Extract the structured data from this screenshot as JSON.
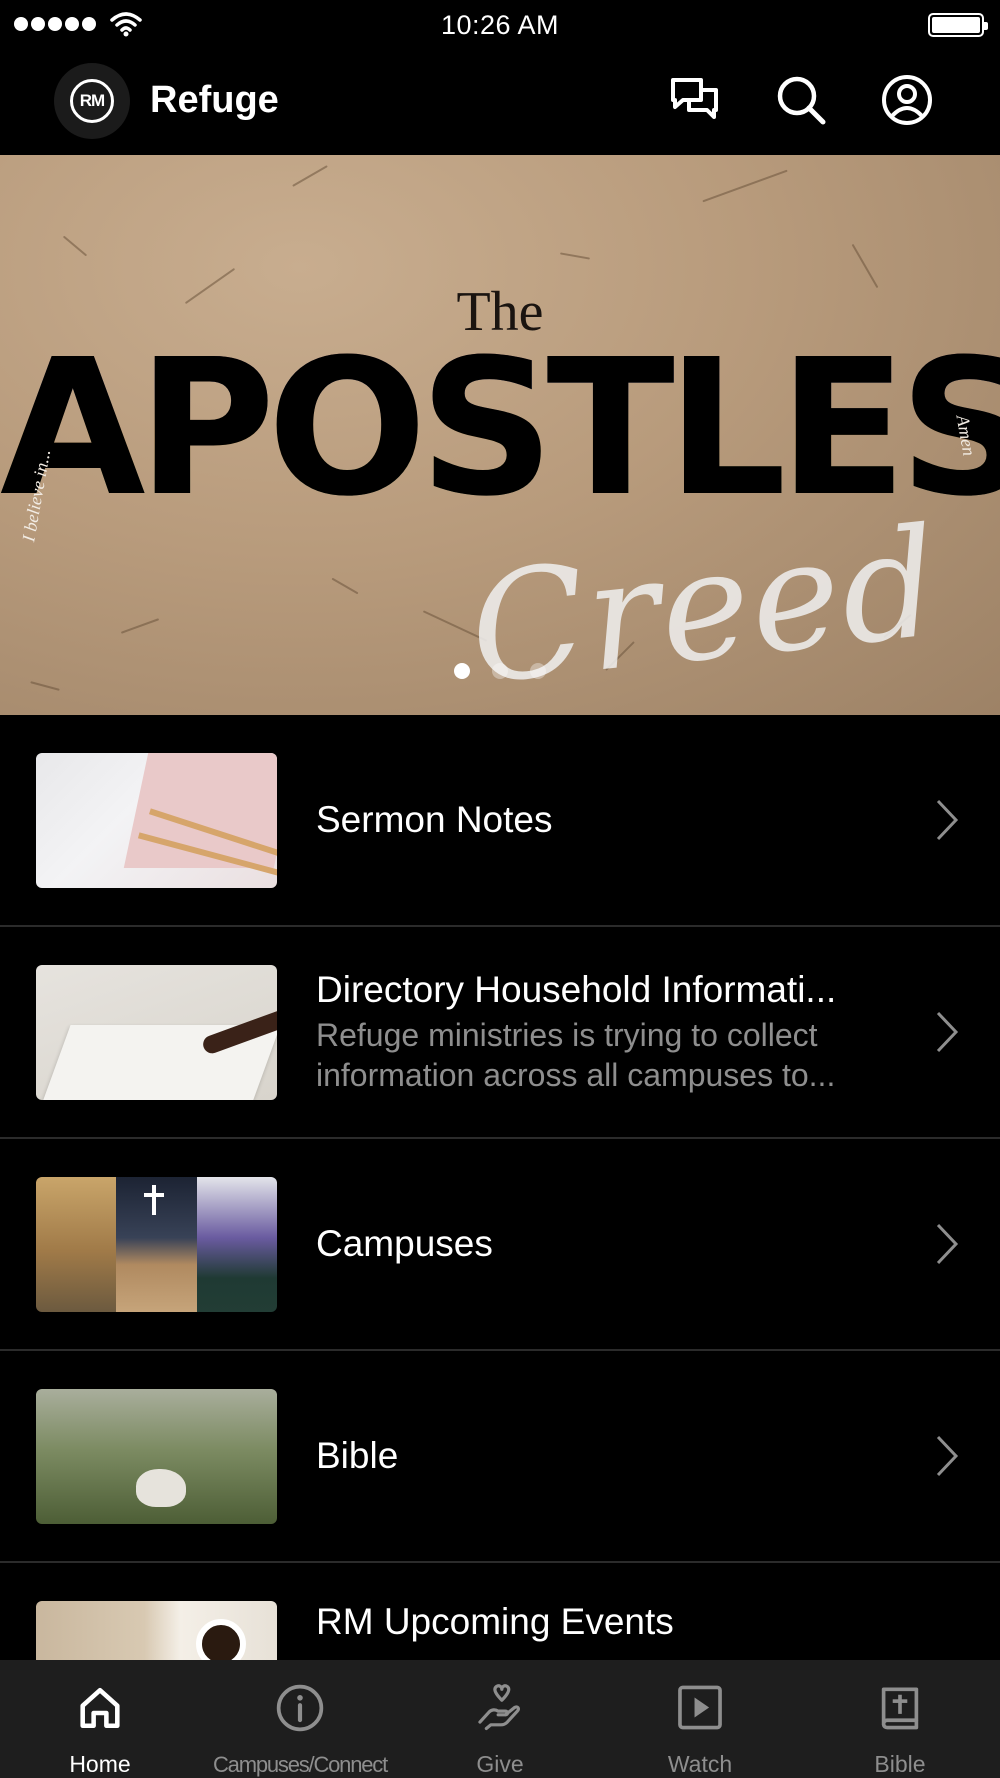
{
  "status_bar": {
    "time": "10:26 AM"
  },
  "header": {
    "logo_text": "RM",
    "title": "Refuge",
    "icons": [
      "chat-bubbles-icon",
      "search-icon",
      "profile-icon"
    ]
  },
  "banner": {
    "small_title": "The",
    "main_title": "APOSTLES",
    "script_title": "Creed",
    "left_caption": "I believe in...",
    "right_caption": "Amen",
    "slide_count": 3,
    "active_slide": 1
  },
  "list": [
    {
      "title": "Sermon Notes",
      "subtitle": ""
    },
    {
      "title": "Directory Household Informati...",
      "subtitle": "Refuge ministries is trying to collect information across all campuses to..."
    },
    {
      "title": "Campuses",
      "subtitle": ""
    },
    {
      "title": "Bible",
      "subtitle": ""
    },
    {
      "title": "RM Upcoming Events",
      "subtitle": ""
    }
  ],
  "tabs": [
    {
      "label": "Home",
      "icon": "home-icon",
      "active": true
    },
    {
      "label": "Campuses/Connect",
      "icon": "info-icon",
      "active": false
    },
    {
      "label": "Give",
      "icon": "give-hand-heart-icon",
      "active": false
    },
    {
      "label": "Watch",
      "icon": "play-icon",
      "active": false
    },
    {
      "label": "Bible",
      "icon": "bible-icon",
      "active": false
    }
  ],
  "colors": {
    "background": "#000000",
    "tab_bar": "#1e1e1e",
    "inactive": "#8e8e8e",
    "divider": "#2b2b2b"
  }
}
